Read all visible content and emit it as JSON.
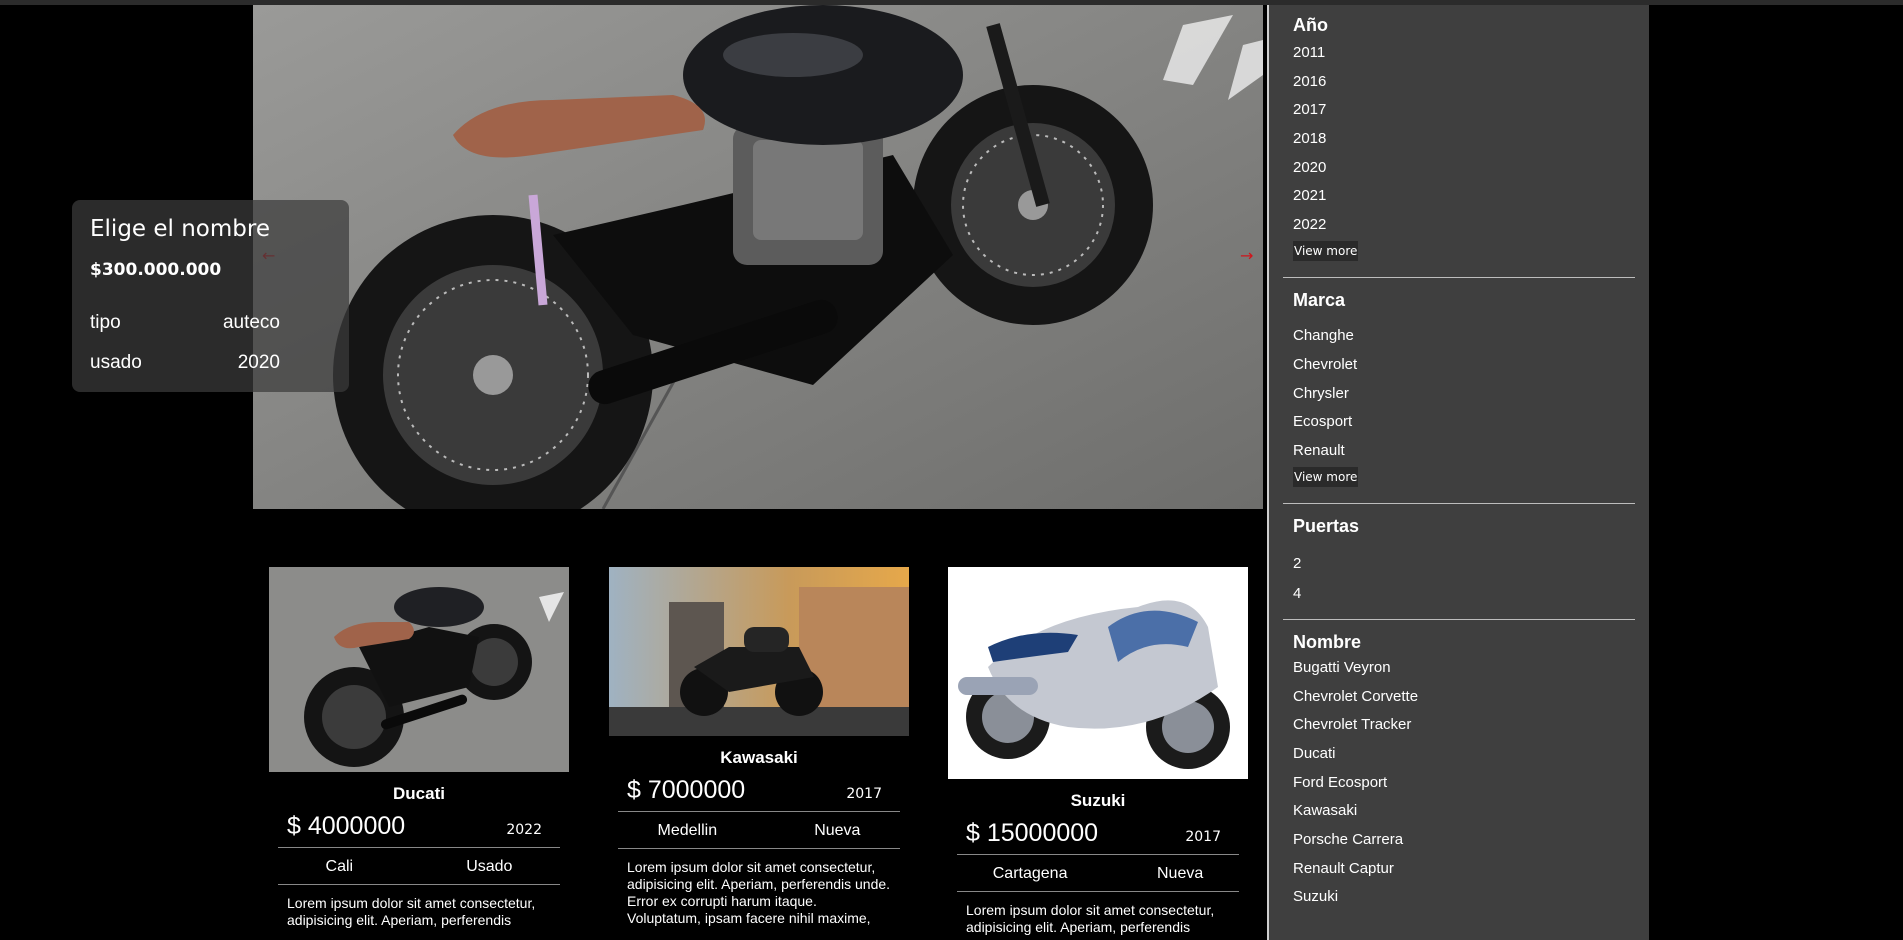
{
  "hero": {
    "title": "Elige el nombre",
    "price": "$300.000.000",
    "row1_left": "tipo",
    "row1_right": "auteco",
    "row2_left": "usado",
    "row2_right": "2020",
    "prev_icon": "arrow-left-icon",
    "next_icon": "arrow-right-icon"
  },
  "cards": [
    {
      "name": "Ducati",
      "price": "$ 4000000",
      "year": "2022",
      "city": "Cali",
      "condition": "Usado",
      "desc": "Lorem ipsum dolor sit amet consectetur, adipisicing elit. Aperiam, perferendis"
    },
    {
      "name": "Kawasaki",
      "price": "$ 7000000",
      "year": "2017",
      "city": "Medellin",
      "condition": "Nueva",
      "desc": "Lorem ipsum dolor sit amet consectetur, adipisicing elit. Aperiam, perferendis unde. Error ex corrupti harum itaque. Voluptatum, ipsam facere nihil maxime,"
    },
    {
      "name": "Suzuki",
      "price": "$ 15000000",
      "year": "2017",
      "city": "Cartagena",
      "condition": "Nueva",
      "desc": "Lorem ipsum dolor sit amet consectetur, adipisicing elit. Aperiam, perferendis"
    }
  ],
  "filters": {
    "year": {
      "title": "Año",
      "items": [
        "2011",
        "2016",
        "2017",
        "2018",
        "2020",
        "2021",
        "2022"
      ],
      "more": "View more"
    },
    "brand": {
      "title": "Marca",
      "items": [
        "Changhe",
        "Chevrolet",
        "Chrysler",
        "Ecosport",
        "Renault"
      ],
      "more": "View more"
    },
    "doors": {
      "title": "Puertas",
      "items": [
        "2",
        "4"
      ]
    },
    "name": {
      "title": "Nombre",
      "items": [
        "Bugatti Veyron",
        "Chevrolet Corvette",
        "Chevrolet Tracker",
        "Ducati",
        "Ford Ecosport",
        "Kawasaki",
        "Porsche Carrera",
        "Renault Captur",
        "Suzuki"
      ]
    }
  },
  "colors": {
    "accent": "#d0141b",
    "sidebar_bg": "#3f3f3f",
    "page_bg": "#000000"
  }
}
